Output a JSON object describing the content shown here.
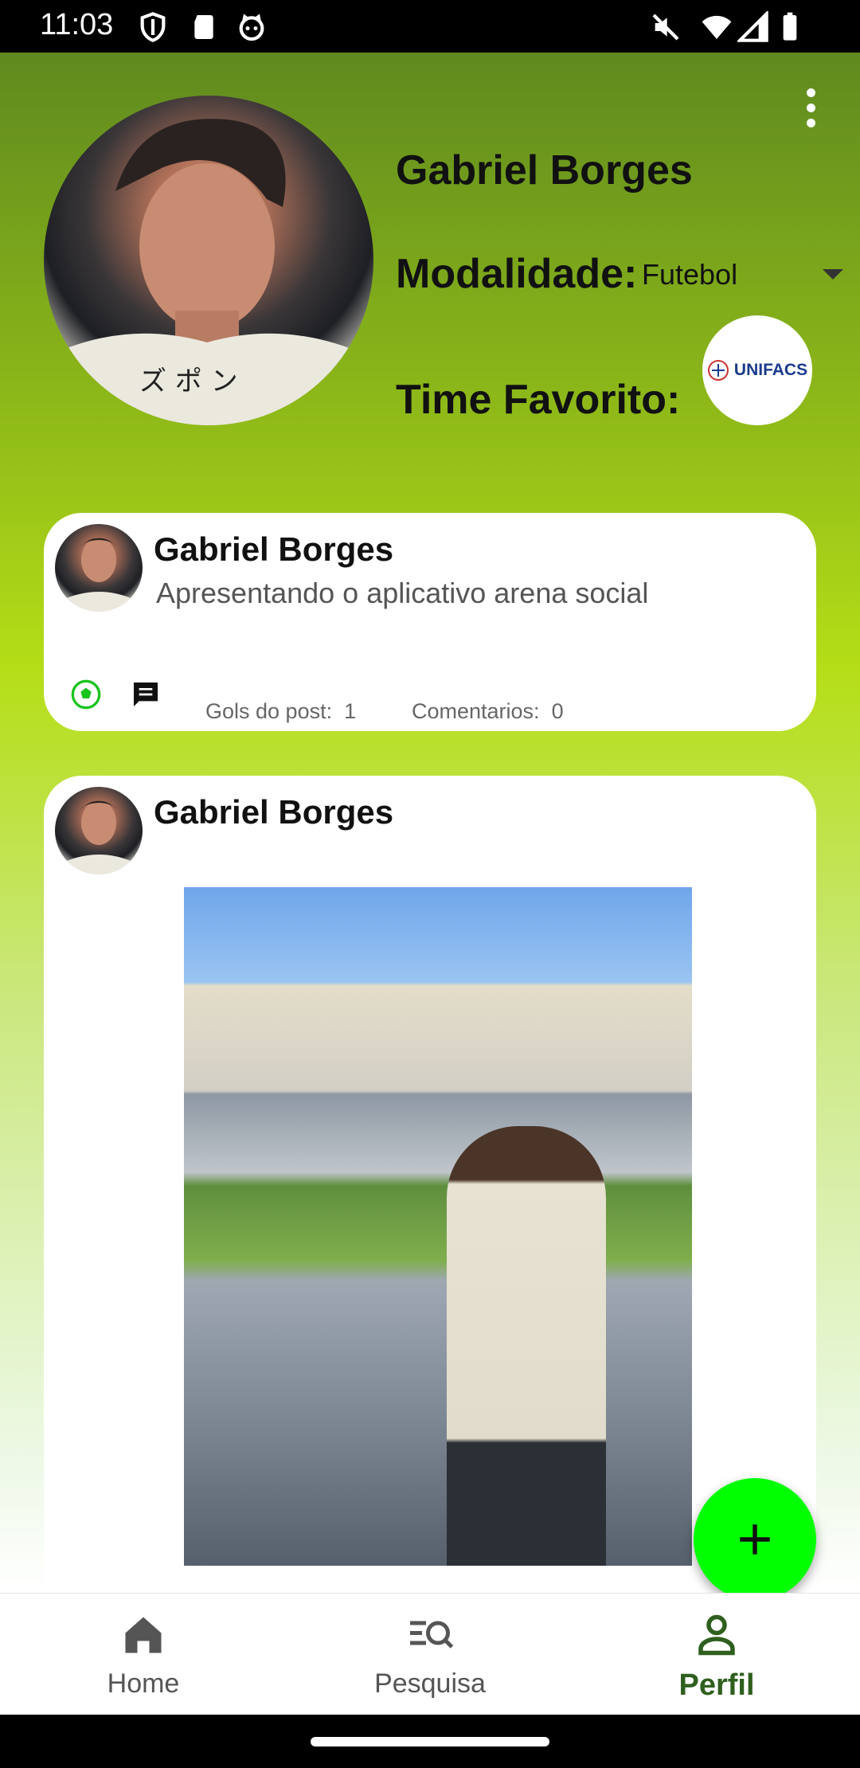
{
  "status_bar": {
    "time": "11:03",
    "left_icons": [
      "shield-icon",
      "sd-card-icon",
      "cat-icon"
    ],
    "right_icons": [
      "mute-icon",
      "wifi-icon",
      "signal-icon",
      "battery-icon"
    ]
  },
  "profile": {
    "name": "Gabriel Borges",
    "modalidade_label": "Modalidade:",
    "modalidade_value": "Futebol",
    "time_label": "Time Favorito:",
    "team_logo_text": "UNIFACS"
  },
  "posts": [
    {
      "author": "Gabriel Borges",
      "text": "Apresentando o aplicativo arena social",
      "gols_label": "Gols do post:",
      "gols_count": "1",
      "comentarios_label": "Comentarios:",
      "comentarios_count": "0"
    },
    {
      "author": "Gabriel Borges"
    }
  ],
  "nav": {
    "items": [
      {
        "label": "Home",
        "icon": "home-icon"
      },
      {
        "label": "Pesquisa",
        "icon": "search-list-icon"
      },
      {
        "label": "Perfil",
        "icon": "person-icon",
        "active": true
      }
    ]
  },
  "colors": {
    "accent": "#00ff00",
    "nav_active": "#2f5f1e",
    "header_top": "#5f8a1f",
    "mid_green": "#b5de17"
  }
}
